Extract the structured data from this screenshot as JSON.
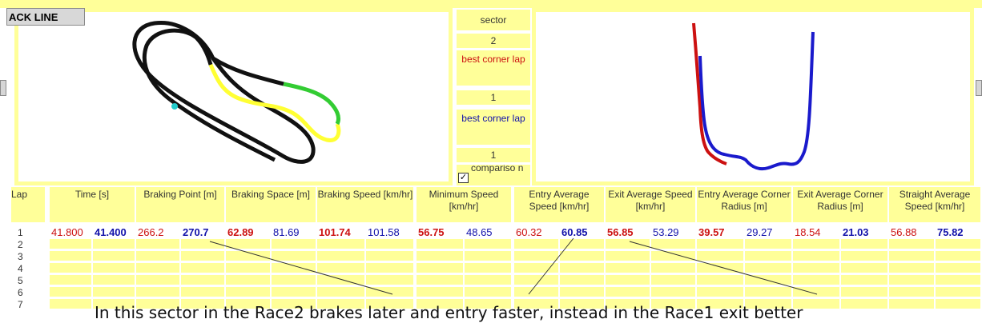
{
  "tab_label": "ACK LINE",
  "sector_panel": {
    "sector_label": "sector",
    "sector_value": "2",
    "best_corner_lap_red": "best  corner lap",
    "best_corner_lap_red_value": "1",
    "best_corner_lap_blue": "best  corner lap",
    "best_corner_lap_blue_value": "1",
    "comparison_label": "compariso n",
    "comparison_checked": true
  },
  "table": {
    "lap_header": "Lap",
    "columns": [
      {
        "label": "Time [s]",
        "red": "41.800",
        "blue": "41.400",
        "red_bold": false,
        "blue_bold": true
      },
      {
        "label": "Braking Point [m]",
        "red": "266.2",
        "blue": "270.7",
        "red_bold": false,
        "blue_bold": true
      },
      {
        "label": "Braking Space [m]",
        "red": "62.89",
        "blue": "81.69",
        "red_bold": true,
        "blue_bold": false
      },
      {
        "label": "Braking Speed [km/hr]",
        "red": "101.74",
        "blue": "101.58",
        "red_bold": true,
        "blue_bold": false
      },
      {
        "label": "Minimum Speed [km/hr]",
        "red": "56.75",
        "blue": "48.65",
        "red_bold": true,
        "blue_bold": false
      },
      {
        "label": "Entry Average Speed [km/hr]",
        "red": "60.32",
        "blue": "60.85",
        "red_bold": false,
        "blue_bold": true
      },
      {
        "label": "Exit Average Speed [km/hr]",
        "red": "56.85",
        "blue": "53.29",
        "red_bold": true,
        "blue_bold": false
      },
      {
        "label": "Entry Average Corner Radius [m]",
        "red": "39.57",
        "blue": "29.27",
        "red_bold": true,
        "blue_bold": false
      },
      {
        "label": "Exit Average Corner Radius [m]",
        "red": "18.54",
        "blue": "21.03",
        "red_bold": false,
        "blue_bold": true
      },
      {
        "label": "Straight Average Speed [km/hr]",
        "red": "56.88",
        "blue": "75.82",
        "red_bold": false,
        "blue_bold": true
      }
    ],
    "laps": [
      "1",
      "2",
      "3",
      "4",
      "5",
      "6",
      "7"
    ]
  },
  "annotation": "In this sector in the Race2 brakes later and entry faster, instead in the Race1 exit better",
  "colors": {
    "panel_yellow": "#ffff99",
    "race1_red": "#cc1111",
    "race2_blue": "#1111aa",
    "track_black": "#111111",
    "track_yellow": "#ffff33",
    "track_green": "#33cc33",
    "marker_cyan": "#22cccc"
  }
}
